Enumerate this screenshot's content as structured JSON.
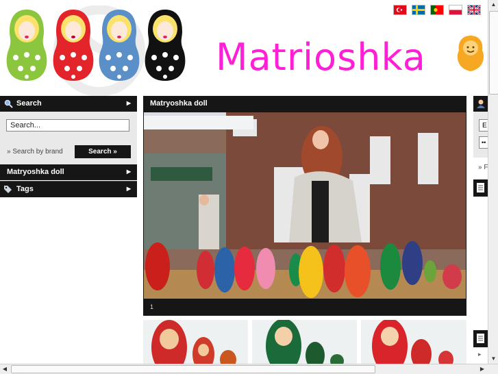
{
  "header": {
    "logo_text": "Matrioshka",
    "flags": [
      "tr",
      "se",
      "pt",
      "pl",
      "gb"
    ]
  },
  "sidebar": {
    "search_title": "Search",
    "search_placeholder": "Search...",
    "search_by_brand": "» Search by brand",
    "search_button": "Search »",
    "category": "Matryoshka doll",
    "tags": "Tags"
  },
  "main": {
    "title": "Matryoshka doll",
    "caption": "1"
  },
  "right": {
    "link": "» F",
    "field_a": "E",
    "field_b": "••"
  },
  "colors": {
    "logo": "#ff1fd6",
    "bar": "#161616"
  }
}
